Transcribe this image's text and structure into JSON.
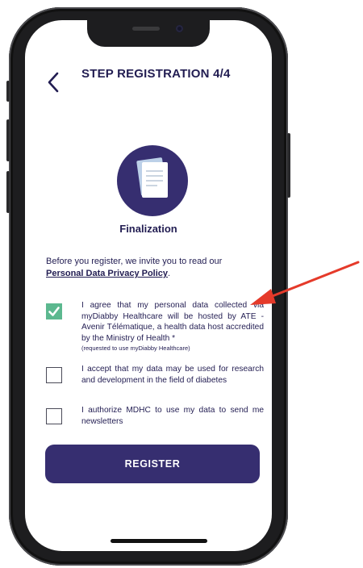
{
  "header": {
    "title": "STEP REGISTRATION 4/4"
  },
  "step": {
    "label": "Finalization"
  },
  "intro": {
    "text": "Before you register, we invite you to read our ",
    "link": "Personal Data Privacy Policy",
    "suffix": "."
  },
  "consents": [
    {
      "text": "I agree that my personal data collected via myDiabby Healthcare will be hosted by ATE - Avenir Télématique, a health data host accredited by the Ministry of Health *",
      "note": "(requested to use myDiabby Healthcare)",
      "checked": true
    },
    {
      "text": "I accept that my data may be used for research and development in the field of diabetes",
      "checked": false
    },
    {
      "text": "I authorize MDHC to use my data to send me newsletters",
      "checked": false
    }
  ],
  "actions": {
    "register_label": "REGISTER"
  },
  "colors": {
    "primary": "#362e70",
    "text": "#221d52",
    "check": "#5cb88f",
    "annotation_arrow": "#e53a2a"
  }
}
